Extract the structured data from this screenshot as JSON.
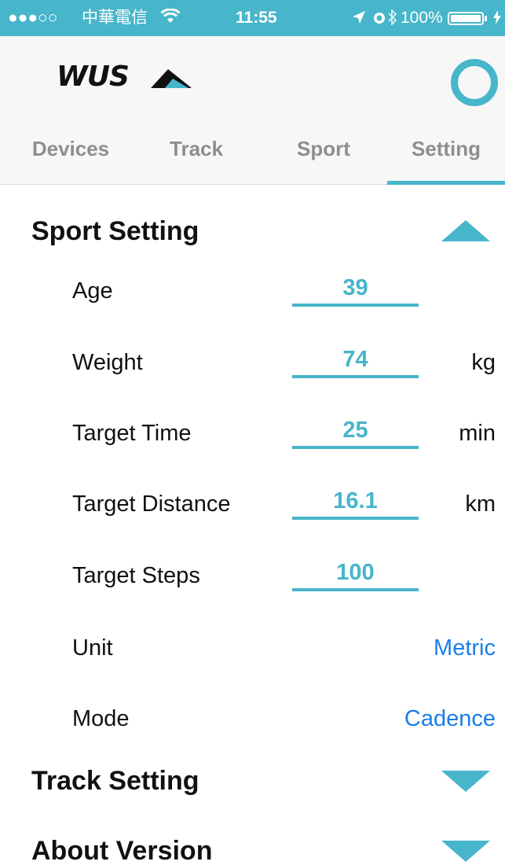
{
  "status_bar": {
    "signal": "●●●○○",
    "carrier": "中華電信",
    "wifi_icon": "wifi-icon",
    "time": "11:55",
    "battery": "100%"
  },
  "header": {
    "logo_text": "WUS",
    "tabs": [
      {
        "label": "Devices"
      },
      {
        "label": "Track"
      },
      {
        "label": "Sport"
      },
      {
        "label": "Setting"
      }
    ],
    "active_tab": "Setting"
  },
  "sport_setting": {
    "title": "Sport Setting",
    "expanded": true,
    "rows": {
      "age": {
        "label": "Age",
        "value": "39",
        "unit": ""
      },
      "weight": {
        "label": "Weight",
        "value": "74",
        "unit": "kg"
      },
      "target_time": {
        "label": "Target Time",
        "value": "25",
        "unit": "min"
      },
      "target_distance": {
        "label": "Target Distance",
        "value": "16.1",
        "unit": "km"
      },
      "target_steps": {
        "label": "Target Steps",
        "value": "100",
        "unit": ""
      }
    },
    "unit": {
      "label": "Unit",
      "value": "Metric"
    },
    "mode": {
      "label": "Mode",
      "value": "Cadence"
    }
  },
  "track_setting": {
    "title": "Track Setting",
    "expanded": false
  },
  "about_version": {
    "title": "About Version",
    "expanded": false
  },
  "colors": {
    "accent": "#47b5ca",
    "link": "#1a7ee6",
    "header_bg": "#f7f7f7",
    "tab_text": "#8e8e8e"
  }
}
